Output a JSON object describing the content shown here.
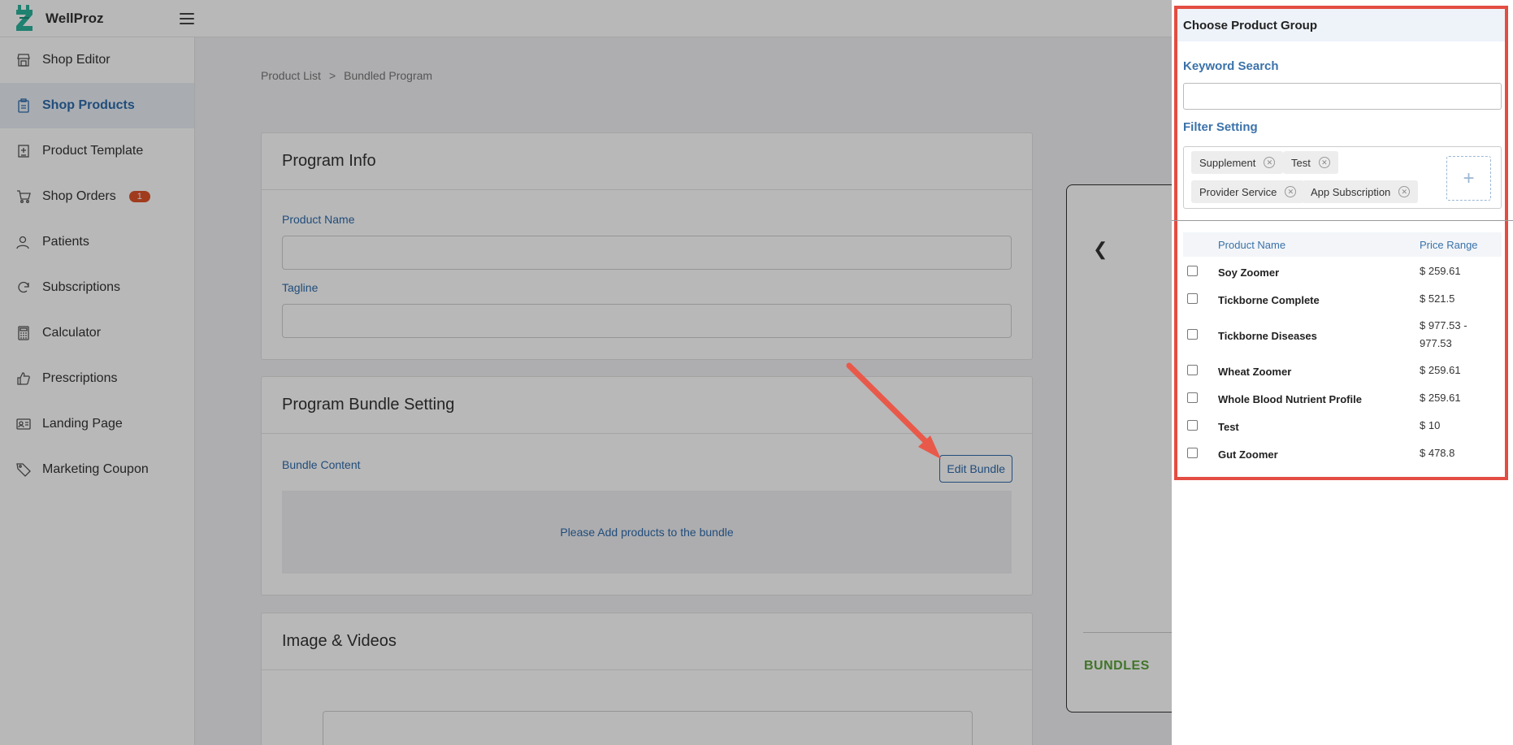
{
  "app": {
    "name": "WellProz"
  },
  "sidebar": {
    "items": [
      {
        "label": "Shop Editor",
        "icon": "store-icon",
        "active": false
      },
      {
        "label": "Shop Products",
        "icon": "clipboard-icon",
        "active": true
      },
      {
        "label": "Product Template",
        "icon": "template-icon",
        "active": false
      },
      {
        "label": "Shop Orders",
        "icon": "cart-icon",
        "active": false,
        "badge": "1"
      },
      {
        "label": "Patients",
        "icon": "user-icon",
        "active": false
      },
      {
        "label": "Subscriptions",
        "icon": "refresh-icon",
        "active": false
      },
      {
        "label": "Calculator",
        "icon": "calculator-icon",
        "active": false
      },
      {
        "label": "Prescriptions",
        "icon": "thumbs-up-icon",
        "active": false
      },
      {
        "label": "Landing Page",
        "icon": "id-card-icon",
        "active": false
      },
      {
        "label": "Marketing Coupon",
        "icon": "tag-icon",
        "active": false
      }
    ]
  },
  "breadcrumb": {
    "parent": "Product List",
    "separator": ">",
    "current": "Bundled Program"
  },
  "program_info": {
    "title": "Program Info",
    "product_name_label": "Product Name",
    "product_name_value": "",
    "tagline_label": "Tagline",
    "tagline_value": ""
  },
  "bundle_setting": {
    "title": "Program Bundle Setting",
    "content_label": "Bundle Content",
    "edit_button": "Edit Bundle",
    "empty_message": "Please Add products to the bundle"
  },
  "media": {
    "title": "Image & Videos"
  },
  "preview": {
    "bundles_label": "BUNDLES"
  },
  "panel": {
    "title": "Choose Product Group",
    "keyword_label": "Keyword Search",
    "keyword_value": "",
    "filter_label": "Filter Setting",
    "filters": [
      "Supplement",
      "Test",
      "Provider Service",
      "App Subscription"
    ],
    "add_filter_symbol": "+",
    "columns": {
      "name": "Product Name",
      "price": "Price Range"
    },
    "products": [
      {
        "name": "Soy Zoomer",
        "price": "$ 259.61",
        "checked": false
      },
      {
        "name": "Tickborne Complete",
        "price": "$ 521.5",
        "checked": false
      },
      {
        "name": "Tickborne Diseases",
        "price": "$ 977.53 - 977.53",
        "checked": false
      },
      {
        "name": "Wheat Zoomer",
        "price": "$ 259.61",
        "checked": false
      },
      {
        "name": "Whole Blood Nutrient Profile",
        "price": "$ 259.61",
        "checked": false
      },
      {
        "name": "Test",
        "price": "$ 10",
        "checked": false
      },
      {
        "name": "Gut Zoomer",
        "price": "$ 478.8",
        "checked": false
      }
    ]
  },
  "colors": {
    "accent": "#2f6bab",
    "badge": "#e0522a",
    "highlight": "#e34d42",
    "brand_green": "#2bb39b",
    "bundles_green": "#5aa23a"
  }
}
